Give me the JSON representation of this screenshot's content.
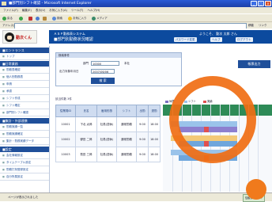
{
  "window": {
    "title": "■部門別シフト確認 - Microsoft Internet Explorer",
    "min": "_",
    "max": "□",
    "close": "×"
  },
  "menu": [
    "ファイル(F)",
    "編集(E)",
    "表示(V)",
    "お気に入り(A)",
    "ツール(T)",
    "ヘルプ(H)"
  ],
  "toolbar": {
    "back": "戻る",
    "search": "検索",
    "favorites": "お気に入り",
    "media": "メディア"
  },
  "address": {
    "label": "アドレス(D)",
    "go": "移動",
    "links": "リンク"
  },
  "app": {
    "logo_text": "勤次くん",
    "system_name": "ＡＳＰ勤務表システム",
    "page_title": "■部門別勤務状況確認",
    "user": "ようこそ、 勤次 太郎 さん",
    "buttons": [
      "パスワード変更",
      "ヘルプ",
      "ログアウト"
    ]
  },
  "sidebar": {
    "sections": [
      {
        "title": "■エントランス",
        "items": [
          "トップ"
        ]
      },
      {
        "title": "■日常業務",
        "items": [
          "勤務表確認",
          "個人別勤務表",
          "申請",
          "承認",
          "シフト作成",
          "シフト確定",
          "部門別シフト確認"
        ]
      },
      {
        "title": "■集計・外部連携",
        "items": [
          "勤務実績一覧",
          "勤務実績確定",
          "集計・勤務実績データ"
        ]
      },
      {
        "title": "■設定",
        "items": [
          "会社情報設定",
          "タイムテーブル設定",
          "勤務打刻登録設定",
          "自分所属設定"
        ]
      }
    ]
  },
  "search": {
    "caption": "検索条件",
    "dept_label": "部門",
    "dept_value": "10000",
    "dept_name": "本社",
    "date_label": "出力対象年月日",
    "date_value": "2007/06/06",
    "search_button": "検 索"
  },
  "print_button": "帳票出力",
  "table": {
    "caption": "該当件数 3件",
    "headers": [
      "従業員ID",
      "氏名",
      "雇用形態",
      "シフト",
      "出勤",
      "退勤"
    ],
    "rows": [
      [
        "10001",
        "下北 太郎",
        "社員(週休)",
        "通常勤務",
        "9:00",
        "18:00"
      ],
      [
        "10002",
        "鬱田 二郎",
        "社員(週休)",
        "通常勤務",
        "9:00",
        "18:00"
      ],
      [
        "10003",
        "勤田 三郎",
        "社員(週休)",
        "通常勤務",
        "9:00",
        "18:00"
      ]
    ]
  },
  "legend": [
    "休憩",
    "シフト",
    "実績"
  ],
  "status": {
    "text": "ページが表示されました",
    "zone": "信頼済みサイト"
  }
}
